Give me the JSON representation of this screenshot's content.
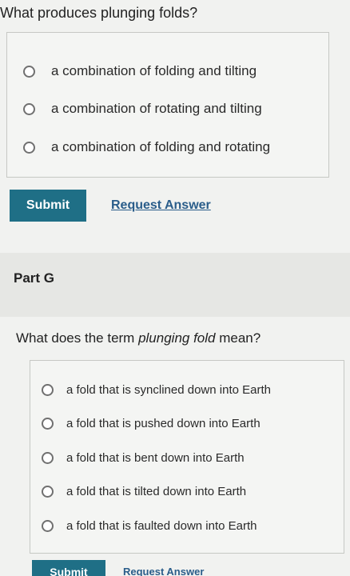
{
  "question1": {
    "text": "What produces plunging folds?"
  },
  "options1": [
    "a combination of folding and tilting",
    "a combination of rotating and tilting",
    "a combination of folding and rotating"
  ],
  "actions1": {
    "submit": "Submit",
    "request": "Request Answer"
  },
  "part_g": {
    "title": "Part G"
  },
  "question2": {
    "prefix": "What does the term ",
    "term": "plunging fold",
    "suffix": " mean?"
  },
  "options2": [
    "a fold that is synclined down into Earth",
    "a fold that is pushed down into Earth",
    "a fold that is bent down into Earth",
    "a fold that is tilted down into Earth",
    "a fold that is faulted down into Earth"
  ],
  "actions2": {
    "submit": "Submit",
    "request": "Request Answer"
  },
  "colors": {
    "button": "#1f6f86",
    "link": "#2a5d8a",
    "background": "#f1f2f0"
  }
}
